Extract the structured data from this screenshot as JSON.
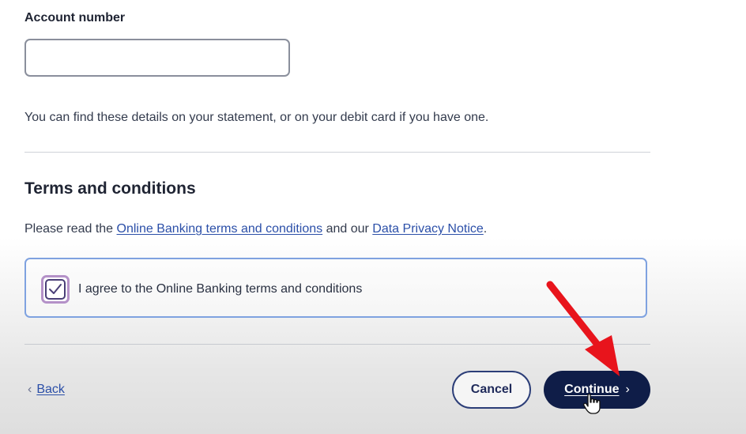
{
  "account": {
    "label": "Account number",
    "value": "",
    "placeholder": ""
  },
  "hint": "You can find these details on your statement, or on your debit card if you have one.",
  "terms": {
    "title": "Terms and conditions",
    "intro_prefix": "Please read the ",
    "link_terms": "Online Banking terms and conditions",
    "intro_middle": " and our ",
    "link_privacy": "Data Privacy Notice",
    "intro_suffix": ".",
    "agree_label": "I agree to the Online Banking terms and conditions",
    "agree_checked": true
  },
  "nav": {
    "back_label": "Back",
    "cancel_label": "Cancel",
    "continue_label": "Continue",
    "back_icon": "chevron-left-icon",
    "continue_icon": "chevron-right-icon"
  },
  "colors": {
    "primary": "#0f1d48",
    "link": "#2b4fa8",
    "focus_border": "#7fa2e0",
    "annotation": "#e8141c"
  }
}
